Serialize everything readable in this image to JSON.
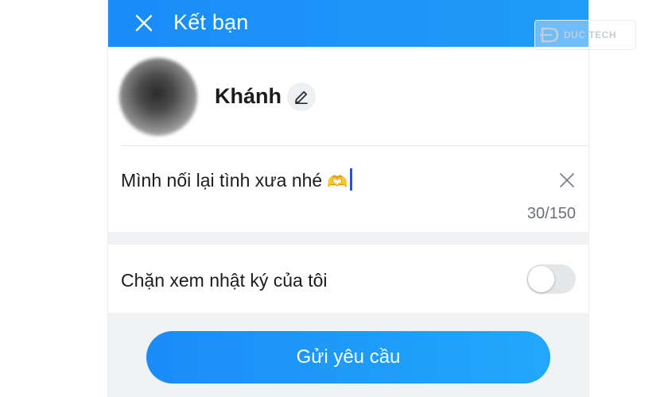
{
  "header": {
    "title": "Kết bạn",
    "close_icon": "close-icon",
    "background": "#1a8cf8"
  },
  "profile": {
    "name": "Khánh",
    "edit_icon": "pencil-icon"
  },
  "message": {
    "value": "Mình nối lại tình xưa nhé",
    "emoji": "🫶",
    "counter": "30/150",
    "clear_icon": "close-icon"
  },
  "privacy": {
    "label": "Chặn xem nhật ký của tôi",
    "toggle_on": false
  },
  "actions": {
    "send_label": "Gửi yêu cầu",
    "accent": "#1a8cf8"
  },
  "watermark": {
    "text": "DUC TECH"
  }
}
